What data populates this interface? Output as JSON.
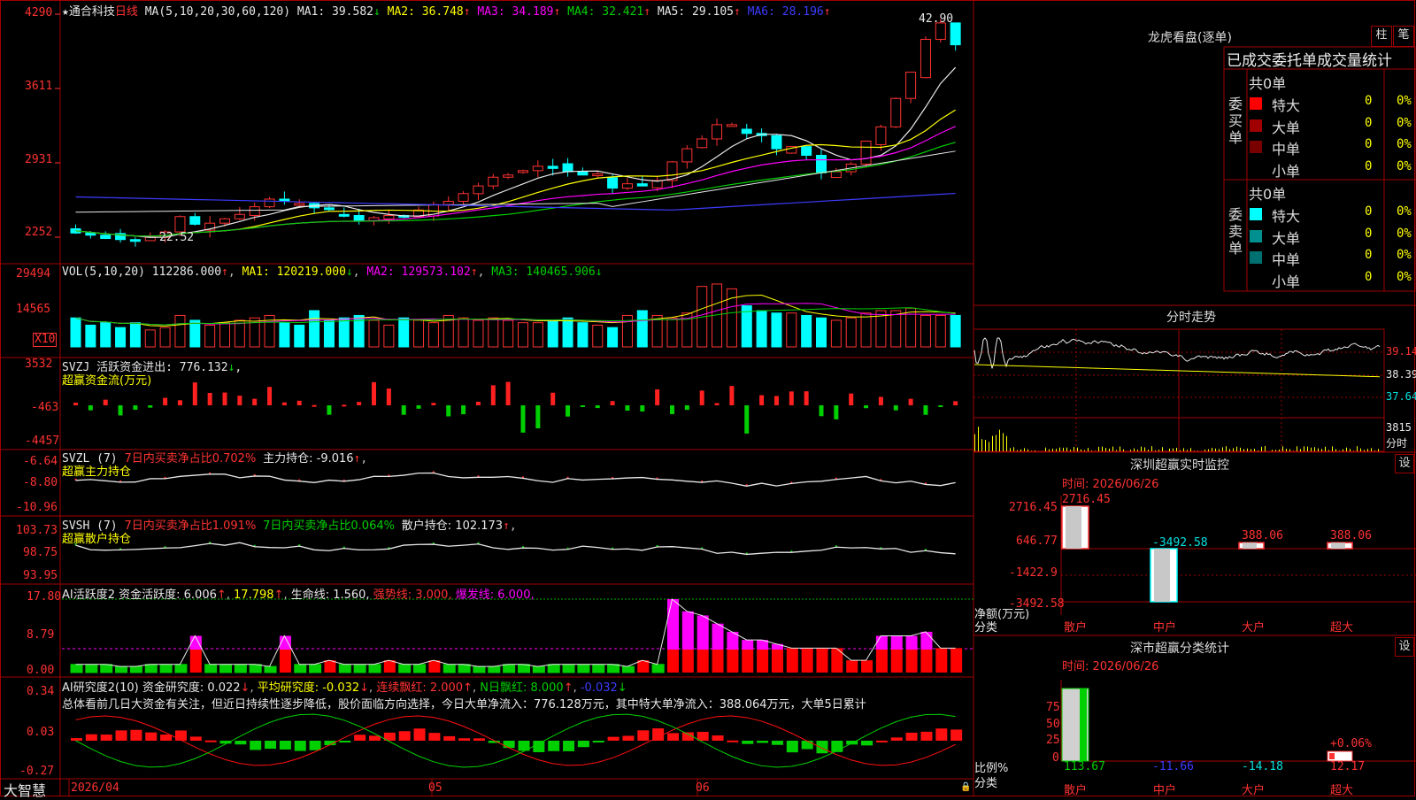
{
  "main": {
    "stock_name": "通合科技",
    "period": "日线",
    "ma_label": "MA(5,10,20,30,60,120)",
    "ma_values": [
      {
        "name": "MA1",
        "value": "39.582",
        "arrow": "↓",
        "color": "#e8e8e8"
      },
      {
        "name": "MA2",
        "value": "36.748",
        "arrow": "↑",
        "color": "#ffff00"
      },
      {
        "name": "MA3",
        "value": "34.189",
        "arrow": "↑",
        "color": "#ff00ff"
      },
      {
        "name": "MA4",
        "value": "32.421",
        "arrow": "↑",
        "color": "#00d000"
      },
      {
        "name": "MA5",
        "value": "29.105",
        "arrow": "↑",
        "color": "#e8e8e8"
      },
      {
        "name": "MA6",
        "value": "28.196",
        "arrow": "↑",
        "color": "#3c3cff"
      }
    ],
    "y_ticks": [
      "4290",
      "3611",
      "2931",
      "2252"
    ],
    "high_label": "42.90",
    "low_label": "22.52"
  },
  "vol": {
    "label": "VOL(5,10,20)",
    "value": "112286.000",
    "ma1": "MA1: 120219.000",
    "ma2": "MA2: 129573.102",
    "ma3": "MA3: 140465.906",
    "y_ticks": [
      "29494",
      "14565"
    ],
    "unit": "X10"
  },
  "svzj": {
    "label": "SVZJ  活跃资金进出: 776.132",
    "sub": "超赢资金流(万元)",
    "y_ticks": [
      "3532",
      "-463",
      "-4457"
    ]
  },
  "svzl": {
    "label_prefix": "SVZL (7)",
    "label_red": "7日内买卖净占比0.702%",
    "label_white": "主力持仓: -9.016",
    "sub": "超赢主力持仓",
    "y_ticks": [
      "-6.64",
      "-8.80",
      "-10.96"
    ]
  },
  "svsh": {
    "label_prefix": "SVSH (7)",
    "label_red": "7日内买卖净占比1.091%",
    "label_green": "7日内买卖净占比0.064%",
    "label_white": "散户持仓: 102.173",
    "sub": "超赢散户持仓",
    "y_ticks": [
      "103.73",
      "98.75",
      "93.95"
    ]
  },
  "ai_active": {
    "label": "AI活跃度2 资金活跃度: 6.006",
    "v2": "17.798",
    "life": "生命线: 1.560,",
    "strong": "强势线: 3.000,",
    "burst": "爆发线: 6.000,",
    "y_ticks": [
      "17.80",
      "8.79",
      "0.00"
    ]
  },
  "ai_research": {
    "label": "AI研究度2(10) 资金研究度: 0.022",
    "avg": "平均研究度: -0.032",
    "red_days": "连续飘红: 2.000",
    "n_red": "N日飘红: 8.000",
    "last": "-0.032",
    "summary": "总体看前几日大资金有关注，但近日持续性逐步降低，股价面临方向选择，今日大单净流入：776.128万元，其中特大单净流入：388.064万元，大单5日累计",
    "y_ticks": [
      "0.34",
      "0.03",
      "-0.27"
    ]
  },
  "x_axis": {
    "labels": [
      "2026/04",
      "05",
      "06"
    ]
  },
  "brand": "大智慧",
  "right": {
    "lhb_title": "龙虎看盘(逐单)",
    "btn_zhu": "柱",
    "btn_bi": "笔",
    "tabs": "已成交委托单成交量统计",
    "buy_group": "委买单",
    "sell_group": "委卖单",
    "buy_total": "共0单",
    "sell_total": "共0单",
    "buy_rows": [
      {
        "name": "特大",
        "count": "0",
        "pct": "0%",
        "color": "#ff0000"
      },
      {
        "name": "大单",
        "count": "0",
        "pct": "0%",
        "color": "#a00000"
      },
      {
        "name": "中单",
        "count": "0",
        "pct": "0%",
        "color": "#7a0000"
      },
      {
        "name": "小单",
        "count": "0",
        "pct": "0%",
        "color": "#000000"
      }
    ],
    "sell_rows": [
      {
        "name": "特大",
        "count": "0",
        "pct": "0%",
        "color": "#00ffff"
      },
      {
        "name": "大单",
        "count": "0",
        "pct": "0%",
        "color": "#009090"
      },
      {
        "name": "中单",
        "count": "0",
        "pct": "0%",
        "color": "#007070"
      },
      {
        "name": "小单",
        "count": "0",
        "pct": "0%",
        "color": "#000000"
      }
    ],
    "fenshi_title": "分时走势",
    "fenshi_ticks": [
      "39.14",
      "38.39",
      "37.64"
    ],
    "fenshi_vol": "3815",
    "fenshi_unit": "分时",
    "monitor_title": "深圳超赢实时监控",
    "monitor_setting": "设",
    "monitor_time": "时间: 2026/06/26",
    "monitor_yticks": [
      "2716.45",
      "646.77",
      "-1422.9",
      "-3492.58"
    ],
    "monitor_ylabel": "净额(万元)",
    "monitor_xlabel": "分类",
    "monitor_cats": [
      "散户",
      "中户",
      "大户",
      "超大"
    ],
    "monitor_values": [
      "2716.45",
      "-3492.58",
      "388.06",
      "388.06"
    ],
    "monitor_data": [
      2716.45,
      -3492.58,
      388.06,
      388.06
    ],
    "stats_title": "深市超赢分类统计",
    "stats_setting": "设",
    "stats_time": "时间: 2026/06/26",
    "stats_yticks": [
      "75",
      "50",
      "25",
      "0"
    ],
    "stats_ylabel": "比例%",
    "stats_xlabel": "分类",
    "stats_cats": [
      "散户",
      "中户",
      "大户",
      "超大"
    ],
    "stats_values": [
      "113.67",
      "-11.66",
      "-14.18",
      "12.17"
    ],
    "stats_extra": "+0.06%"
  }
}
